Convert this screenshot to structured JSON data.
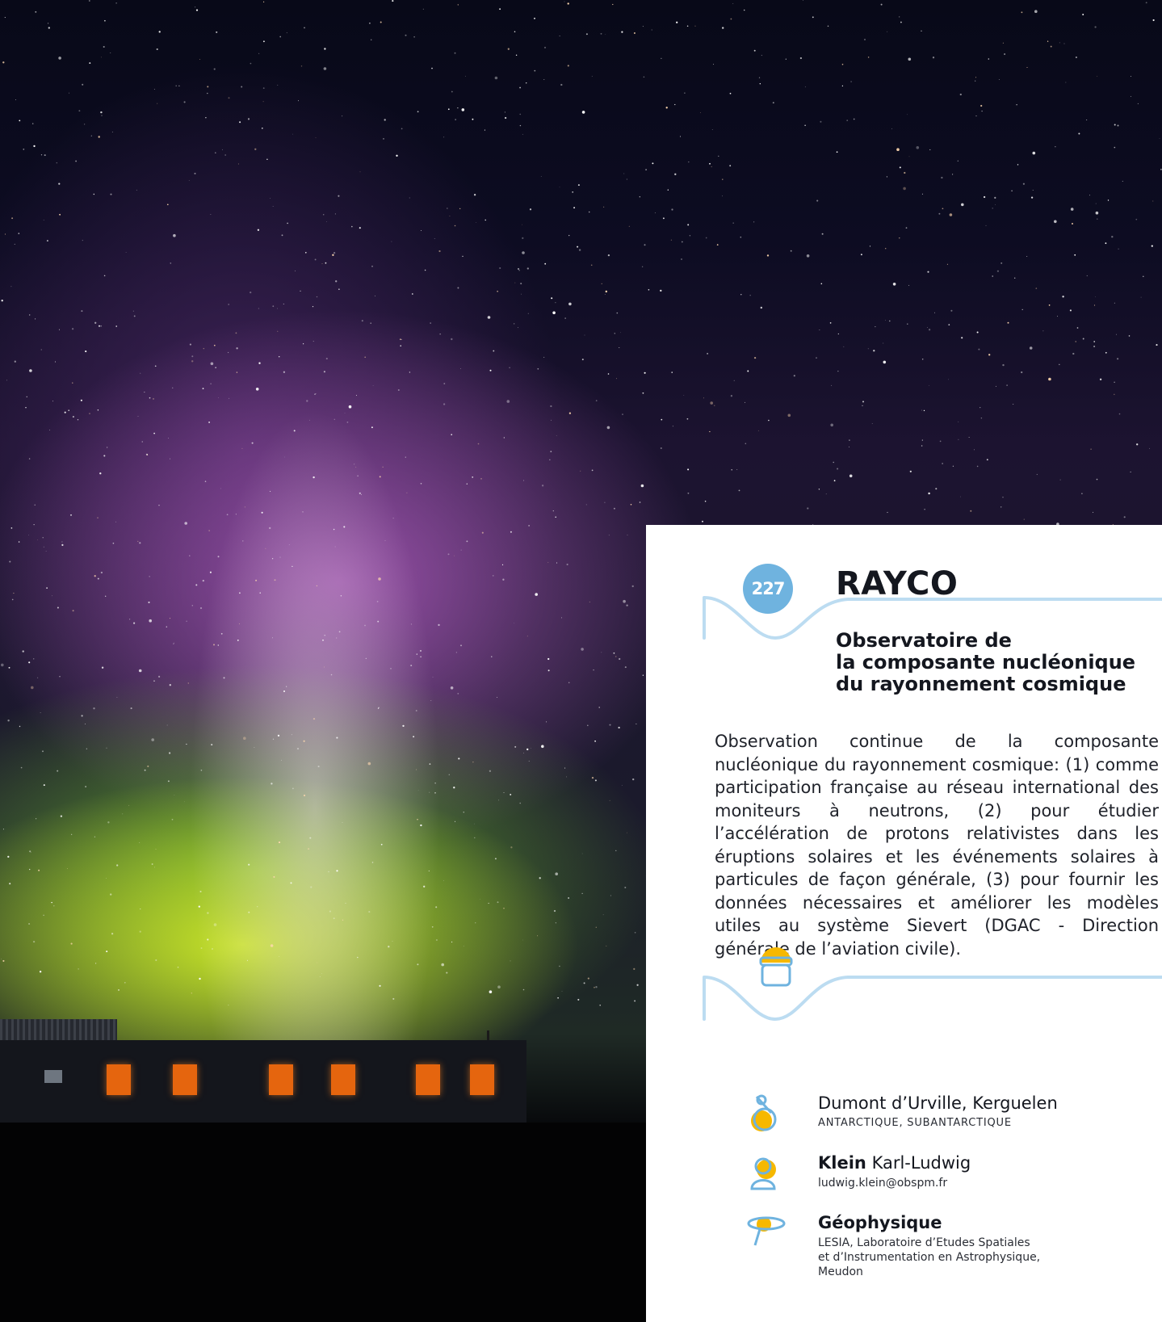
{
  "record": {
    "number": "227",
    "title": "RAYCO",
    "subtitle": "Observatoire de\nla composante nucléonique\ndu rayonnement cosmique",
    "description": "Observation continue de la composante nucléonique du rayonnement cosmique: (1) comme participation française au réseau international des moniteurs à neutrons, (2) pour étudier l’accélération de protons relativistes dans les éruptions solaires et les événements solaires à particules de façon générale, (3) pour fournir les données nécessaires et améliorer les modèles utiles au système Sievert (DGAC - Direction générale de l’aviation civile)."
  },
  "location": {
    "sites": "Dumont d’Urville, Kerguelen",
    "region": "ANTARCTIQUE, SUBANTARCTIQUE"
  },
  "contact": {
    "last_name": "Klein",
    "first_name": "Karl-Ludwig",
    "email": "ludwig.klein@obspm.fr"
  },
  "discipline": {
    "name": "Géophysique",
    "laboratory": "LESIA, Laboratoire d’Etudes Spatiales\net d’Instrumentation en Astrophysique,\nMeudon"
  },
  "colors": {
    "accent_blue": "#6fb3df",
    "line_blue": "#bcdcf1",
    "accent_yellow": "#f6b800"
  },
  "icons": {
    "header": "circle-badge",
    "separator": "jar-icon",
    "location": "location-pin-icon",
    "contact": "person-icon",
    "discipline": "satellite-icon"
  }
}
